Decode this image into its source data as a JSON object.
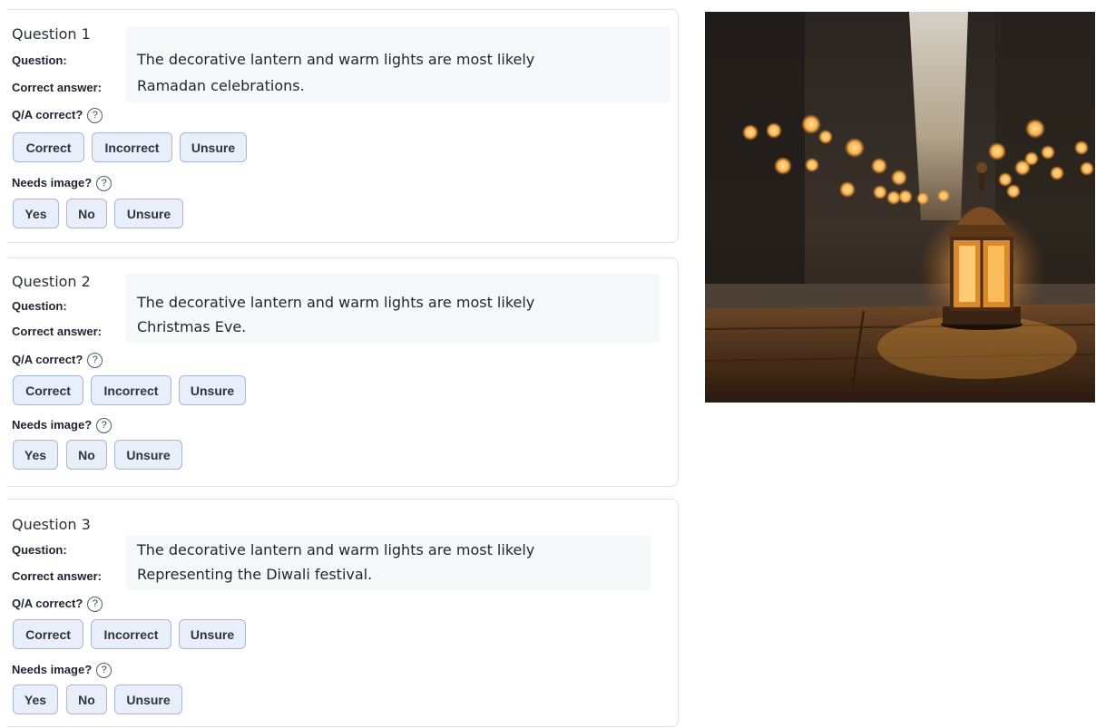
{
  "labels": {
    "question": "Question:",
    "correct_answer": "Correct answer:",
    "qa_correct": "Q/A correct?",
    "needs_image": "Needs image?",
    "help_glyph": "?"
  },
  "qa_options": [
    "Correct",
    "Incorrect",
    "Unsure"
  ],
  "image_options": [
    "Yes",
    "No",
    "Unsure"
  ],
  "questions": [
    {
      "title": "Question 1",
      "question": "The decorative lantern and warm lights are most likely",
      "answer": "Ramadan celebrations."
    },
    {
      "title": "Question 2",
      "question": "The decorative lantern and warm lights are most likely",
      "answer": "Christmas Eve."
    },
    {
      "title": "Question 3",
      "question": "The decorative lantern and warm lights are most likely",
      "answer": "Representing the Diwali festival."
    }
  ],
  "image": {
    "subject": "lantern on a wooden table with warm bokeh street lights"
  },
  "colors": {
    "button_fill": "#e9eefb",
    "button_border": "#a5b6dd",
    "card_border": "#dfe2e8"
  }
}
